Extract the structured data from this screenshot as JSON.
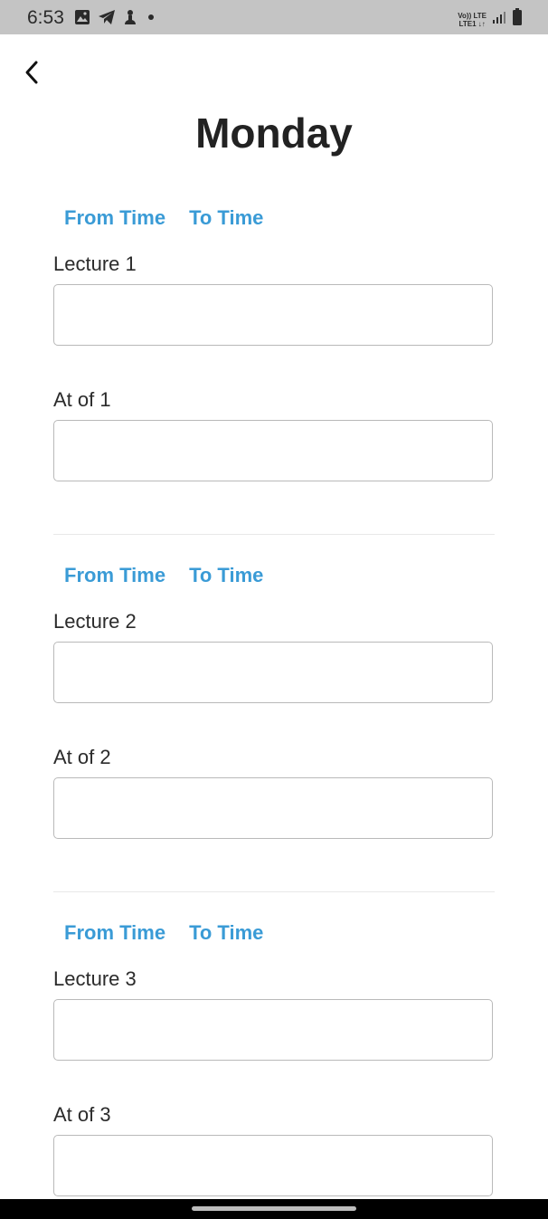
{
  "status_bar": {
    "time": "6:53",
    "network_top": "Vo)) LTE",
    "network_bottom": "LTE1 ↓↑",
    "icons": [
      "image-icon",
      "telegram-icon",
      "app-icon",
      "dot-icon",
      "signal-icon",
      "battery-icon"
    ]
  },
  "header": {
    "back_icon": "chevron-left-icon",
    "title": "Monday"
  },
  "colors": {
    "accent": "#3a9bd6",
    "status_bar_bg": "#c4c4c4",
    "text": "#222222"
  },
  "lectures": [
    {
      "from_label": "From Time",
      "to_label": "To Time",
      "lecture_label": "Lecture 1",
      "lecture_value": "",
      "at_label": "At of 1",
      "at_value": ""
    },
    {
      "from_label": "From Time",
      "to_label": "To Time",
      "lecture_label": "Lecture 2",
      "lecture_value": "",
      "at_label": "At of 2",
      "at_value": ""
    },
    {
      "from_label": "From Time",
      "to_label": "To Time",
      "lecture_label": "Lecture 3",
      "lecture_value": "",
      "at_label": "At of 3",
      "at_value": ""
    }
  ]
}
